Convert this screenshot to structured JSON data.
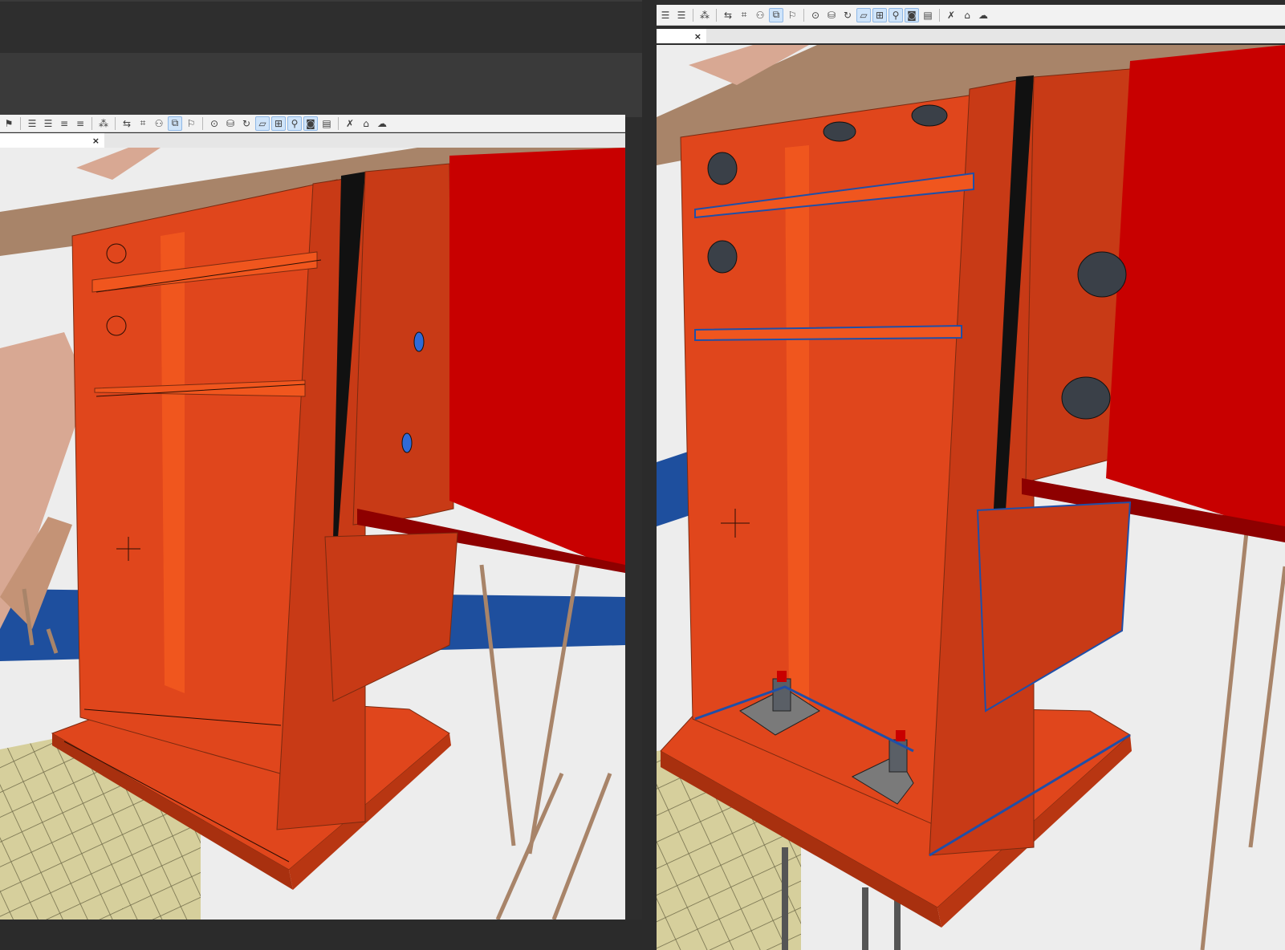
{
  "left_view": {
    "tab_close": "×",
    "toolbar_icons": [
      "layers-icon",
      "align-left-icon",
      "align-center-icon",
      "align-right-icon",
      "align-justify-icon",
      "magic-wand-icon",
      "undo-icon",
      "select-icon",
      "group-icon",
      "view-link-icon",
      "flag-icon",
      "check-circle-icon",
      "database-icon",
      "refresh-icon",
      "plane-icon",
      "grid-icon",
      "person-icon",
      "zoom-icon",
      "panel-icon",
      "fx-icon",
      "tag-icon",
      "cloud-icon"
    ]
  },
  "right_view": {
    "tab_close": "×",
    "toolbar_icons": [
      "align-left-icon",
      "align-right-icon",
      "magic-wand-icon",
      "undo-icon",
      "select-icon",
      "group-icon",
      "view-link-icon",
      "flag-icon",
      "check-circle-icon",
      "database-icon",
      "refresh-icon",
      "plane-icon",
      "grid-icon",
      "person-icon",
      "zoom-icon",
      "panel-icon",
      "fx-icon",
      "tag-icon",
      "cloud-icon"
    ]
  },
  "colors": {
    "steel_orange": "#e0461c",
    "steel_orange_dark": "#a8300f",
    "beam_red": "#c80000",
    "beam_red_dark": "#8e0000",
    "concrete_tan": "#a88469",
    "weld_blue": "#1f4fa8",
    "toolbar_bg": "#f2f2f2",
    "viewport_bg": "#ededed"
  }
}
